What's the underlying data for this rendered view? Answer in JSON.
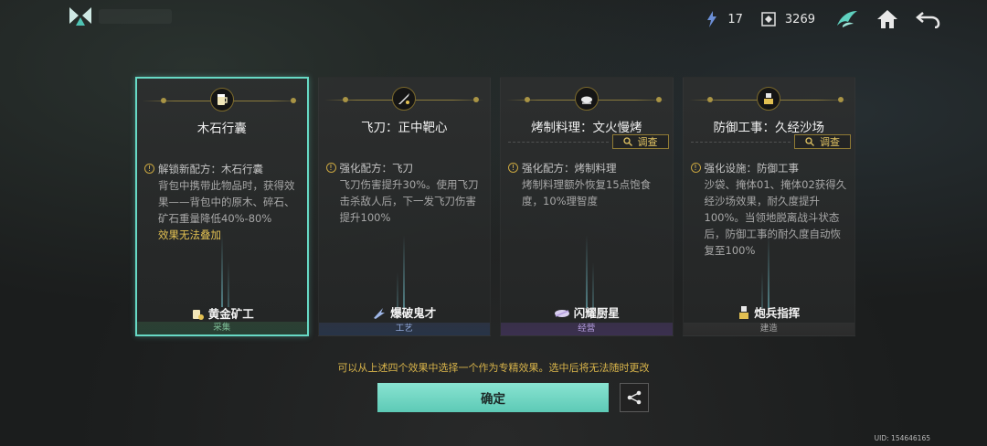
{
  "topbar": {
    "resource_a": "17",
    "resource_b": "3269",
    "icons": [
      "logo-icon",
      "energy-icon",
      "currency-icon",
      "wing-icon",
      "home-icon",
      "back-icon"
    ]
  },
  "cards": [
    {
      "icon": "beer-mug-icon",
      "title": "木石行囊",
      "investigate": null,
      "desc_head": "解锁新配方：木石行囊",
      "desc_body": "背包中携带此物品时，获得效果——背包中的原木、碎石、矿石重量降低40%-80%",
      "desc_note": "效果无法叠加",
      "profession": "黄金矿工",
      "profession_icon": "gold-miner-icon",
      "footer": "采集",
      "selected": true
    },
    {
      "icon": "knife-icon",
      "title": "飞刀：正中靶心",
      "investigate": null,
      "desc_head": "强化配方：飞刀",
      "desc_body": "飞刀伤害提升30%。使用飞刀击杀敌人后，下一发飞刀伤害提升100%",
      "desc_note": "",
      "profession": "爆破鬼才",
      "profession_icon": "blast-icon",
      "footer": "工艺",
      "selected": false
    },
    {
      "icon": "grill-icon",
      "title": "烤制料理：文火慢烤",
      "investigate": "调查",
      "desc_head": "强化配方：烤制料理",
      "desc_body": "烤制料理额外恢复15点饱食度，10%理智度",
      "desc_note": "",
      "profession": "闪耀厨星",
      "profession_icon": "chef-icon",
      "footer": "经营",
      "selected": false
    },
    {
      "icon": "fortress-icon",
      "title": "防御工事：久经沙场",
      "investigate": "调查",
      "desc_head": "强化设施：防御工事",
      "desc_body": "沙袋、掩体01、掩体02获得久经沙场效果，耐久度提升100%。当领地脱离战斗状态后，防御工事的耐久度自动恢复至100%",
      "desc_note": "",
      "profession": "炮兵指挥",
      "profession_icon": "artillery-icon",
      "footer": "建造",
      "selected": false
    }
  ],
  "hint": "可以从上述四个效果中选择一个作为专精效果。选中后将无法随时更改",
  "confirm_label": "确定",
  "uid": "UID: 154646165",
  "colors": {
    "accent": "#67d9c5",
    "gold": "#e2c052",
    "confirm": "#6fd5c1"
  }
}
